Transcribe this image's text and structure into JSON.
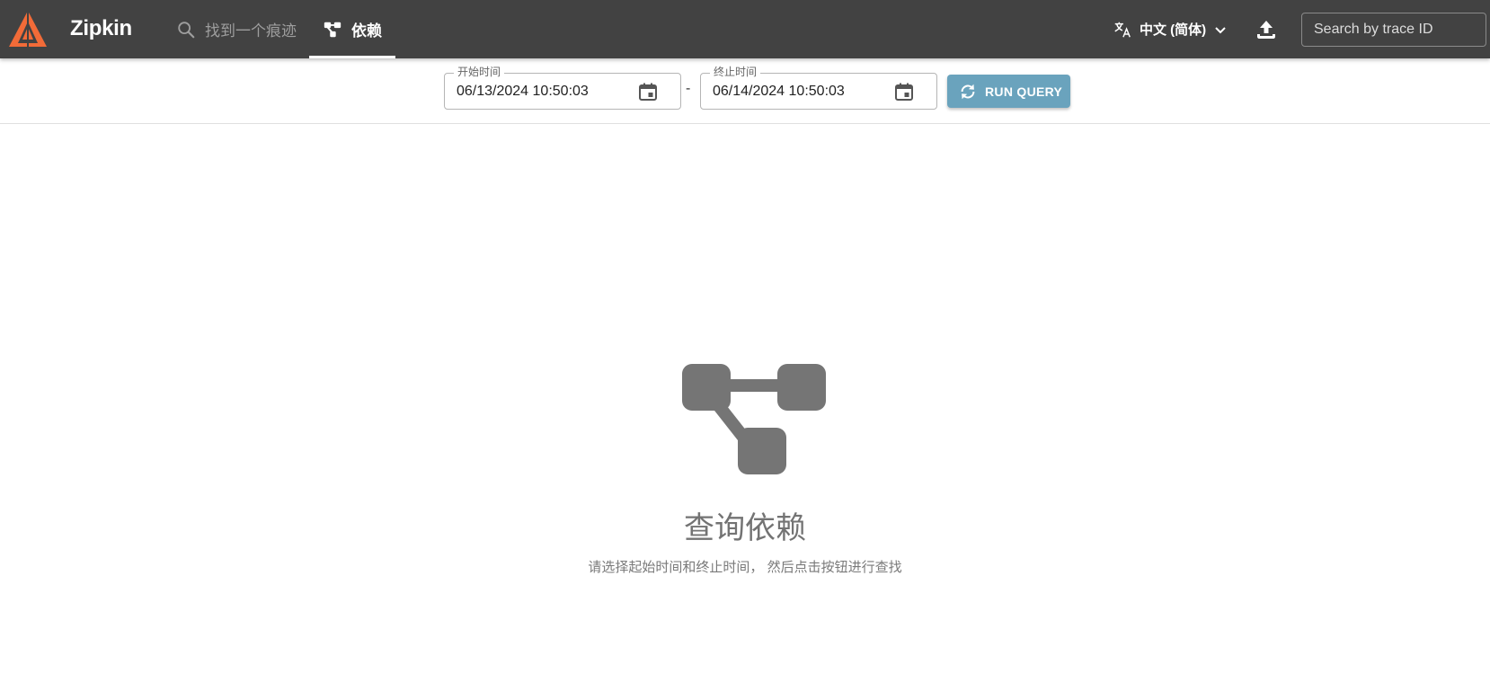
{
  "appbar": {
    "brand": "Zipkin",
    "tabs": [
      {
        "label": "找到一个痕迹",
        "icon": "search-icon"
      },
      {
        "label": "依赖",
        "icon": "dependencies-icon"
      }
    ],
    "language": "中文 (简体)",
    "trace_search_placeholder": "Search by trace ID",
    "colors": {
      "bar": "#424242",
      "logo": "#f26b38"
    }
  },
  "query": {
    "start_label": "开始时间",
    "start_value": "06/13/2024 10:50:03",
    "separator": "-",
    "end_label": "终止时间",
    "end_value": "06/14/2024 10:50:03",
    "run_label": "RUN QUERY",
    "run_color": "#6aa3bd"
  },
  "empty_state": {
    "icon": "dependency-graph-icon",
    "title": "查询依赖",
    "subtitle": "请选择起始时间和终止时间， 然后点击按钮进行查找"
  }
}
